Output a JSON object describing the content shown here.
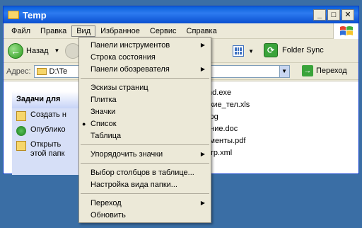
{
  "window": {
    "title": "Temp"
  },
  "menubar": {
    "items": [
      {
        "label": "Файл"
      },
      {
        "label": "Правка"
      },
      {
        "label": "Вид"
      },
      {
        "label": "Избранное"
      },
      {
        "label": "Сервис"
      },
      {
        "label": "Справка"
      }
    ]
  },
  "toolbar": {
    "back_label": "Назад",
    "folder_sync_label": "Folder Sync"
  },
  "address": {
    "label": "Адрес:",
    "value": "D:\\Te",
    "go_label": "Переход"
  },
  "taskpane": {
    "header": "Задачи для",
    "tasks": [
      {
        "label": "Создать н"
      },
      {
        "label": "Опублико"
      },
      {
        "label": "Открыть\nэтой папк"
      }
    ]
  },
  "files": [
    {
      "name": "md.exe"
    },
    {
      "name": "ские_тел.xls"
    },
    {
      "name": ".jpg"
    },
    {
      "name": "ение.doc"
    },
    {
      "name": "ументы.pdf"
    },
    {
      "name": "отр.xml"
    }
  ],
  "view_menu": {
    "groups": [
      [
        {
          "label": "Панели инструментов",
          "submenu": true
        },
        {
          "label": "Строка состояния",
          "submenu": false
        },
        {
          "label": "Панели обозревателя",
          "submenu": true
        }
      ],
      [
        {
          "label": "Эскизы страниц",
          "submenu": false
        },
        {
          "label": "Плитка",
          "submenu": false
        },
        {
          "label": "Значки",
          "submenu": false
        },
        {
          "label": "Список",
          "submenu": false,
          "checked": true
        },
        {
          "label": "Таблица",
          "submenu": false
        }
      ],
      [
        {
          "label": "Упорядочить значки",
          "submenu": true
        }
      ],
      [
        {
          "label": "Выбор столбцов в таблице...",
          "submenu": false
        },
        {
          "label": "Настройка вида папки...",
          "submenu": false
        }
      ],
      [
        {
          "label": "Переход",
          "submenu": true
        },
        {
          "label": "Обновить",
          "submenu": false
        }
      ]
    ]
  }
}
